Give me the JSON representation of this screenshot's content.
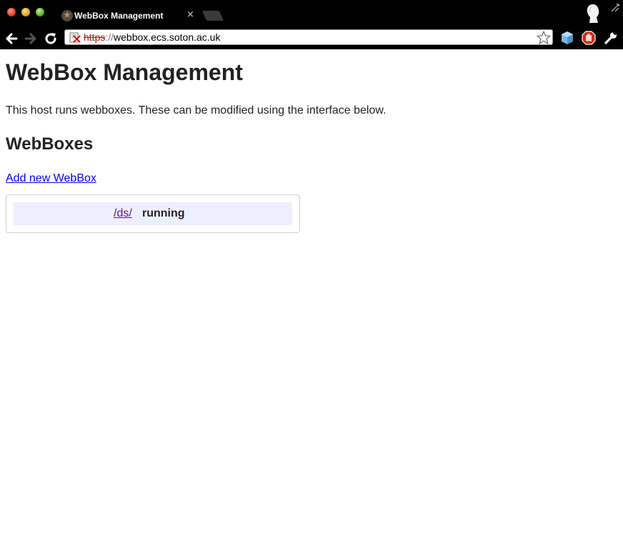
{
  "browser": {
    "tab_title": "WebBox Management",
    "tab_close": "×",
    "url": {
      "scheme": "https",
      "separator": "://",
      "host": "webbox.ecs.soton.ac.uk"
    },
    "icons": [
      "star-icon",
      "back-arrow-icon",
      "forward-arrow-icon",
      "reload-icon",
      "broken-lock-icon",
      "bookmark-star-icon",
      "cube-extension-icon",
      "adblock-icon",
      "wrench-icon",
      "profile-icon",
      "resize-icon"
    ]
  },
  "page": {
    "title": "WebBox Management",
    "intro": "This host runs webboxes. These can be modified using the interface below.",
    "section_heading": "WebBoxes",
    "add_link": "Add new WebBox",
    "webboxes": [
      {
        "path": "/ds/",
        "status": "running"
      }
    ]
  },
  "colors": {
    "chrome_background": "#000000",
    "link": "#0000ee",
    "visited_link": "#551a8b",
    "row_background": "#efeefc",
    "insecure_scheme": "#b01818"
  }
}
